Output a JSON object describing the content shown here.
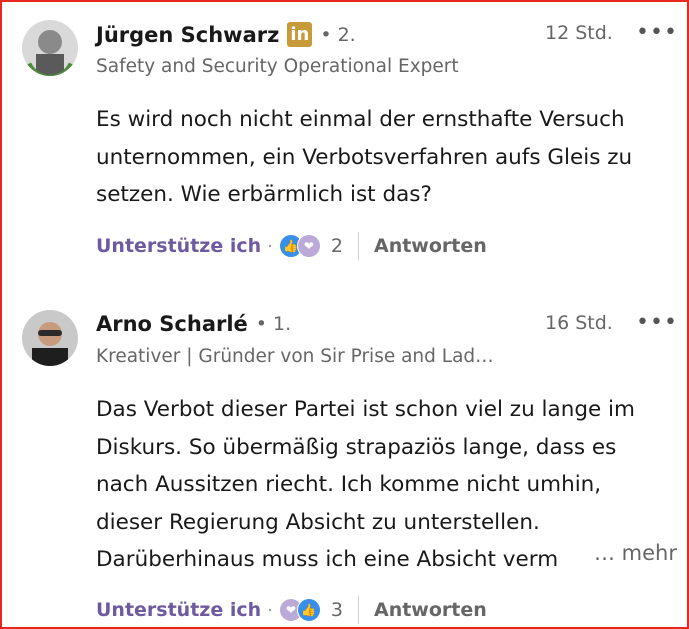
{
  "comments": [
    {
      "author": "Jürgen Schwarz",
      "badge": "in",
      "degree": "• 2.",
      "headline": "Safety and Security Operational Expert",
      "time": "12 Std.",
      "menu": "•••",
      "avatar_icon": "profile-photo",
      "body_lines": [
        "Es wird noch nicht einmal der ernsthafte Versuch",
        "unternommen, ein Verbotsverfahren aufs Gleis zu",
        "setzen. Wie erbärmlich ist das?"
      ],
      "support_label": "Unterstütze ich",
      "separator": "·",
      "reaction_count": "2",
      "reply_label": "Antworten"
    },
    {
      "author": "Arno Scharlé",
      "degree": "• 1.",
      "headline": "Kreativer | Gründer von Sir Prise and Lad…",
      "time": "16 Std.",
      "menu": "•••",
      "avatar_icon": "profile-photo",
      "body_lines": [
        "Das Verbot dieser Partei ist schon viel zu lange im",
        "Diskurs. So übermäßig strapaziös lange, dass es",
        "nach Aussitzen riecht. Ich komme nicht umhin,",
        "dieser Regierung Absicht zu unterstellen.",
        "Darüberhinaus muss ich eine Absicht verm"
      ],
      "more_label": "… mehr",
      "support_label": "Unterstütze ich",
      "separator": "·",
      "reaction_count": "3",
      "reply_label": "Antworten"
    }
  ],
  "colors": {
    "accent_purple": "#6f5aa0",
    "linkedin_badge": "#c79a3a",
    "like_blue": "#378fe9",
    "frame_red": "#e8281e"
  }
}
